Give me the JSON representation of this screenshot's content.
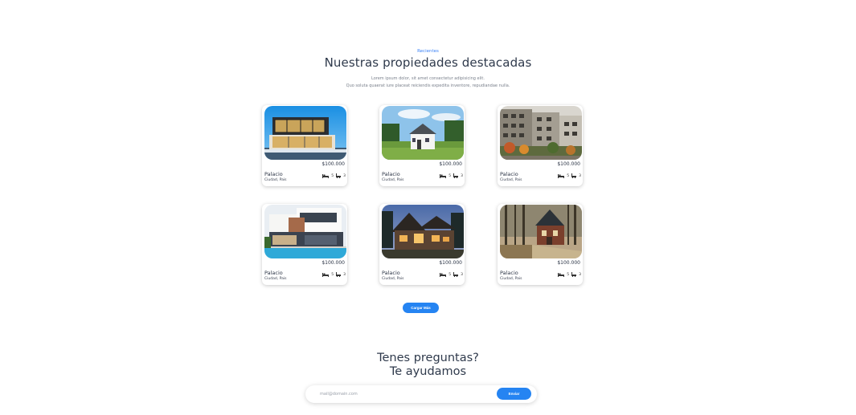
{
  "featured": {
    "eyebrow": "Recientes",
    "title": "Nuestras propiedades destacadas",
    "subtitle_line1": "Lorem ipsum dolor, sit amet consectetur adipisicing elit.",
    "subtitle_line2": "Quo soluta quaerat iure placeat reiciendis expedita inventore, repudiandae nulla."
  },
  "properties": [
    {
      "price": "$100.000",
      "name": "Palacio",
      "location": "Ciudad, Pais",
      "beds": "5",
      "baths": "3",
      "photo": "modern-glass-house"
    },
    {
      "price": "$100.000",
      "name": "Palacio",
      "location": "Ciudad, Pais",
      "beds": "5",
      "baths": "3",
      "photo": "white-cottage"
    },
    {
      "price": "$100.000",
      "name": "Palacio",
      "location": "Ciudad, Pais",
      "beds": "5",
      "baths": "3",
      "photo": "apartment-block"
    },
    {
      "price": "$100.000",
      "name": "Palacio",
      "location": "Ciudad, Pais",
      "beds": "5",
      "baths": "3",
      "photo": "pool-villa"
    },
    {
      "price": "$100.000",
      "name": "Palacio",
      "location": "Ciudad, Pais",
      "beds": "5",
      "baths": "3",
      "photo": "dusk-house"
    },
    {
      "price": "$100.000",
      "name": "Palacio",
      "location": "Ciudad, Pais",
      "beds": "5",
      "baths": "3",
      "photo": "forest-brick-house"
    }
  ],
  "load_more_label": "Cargar Más",
  "faq": {
    "title_line1": "Tenes preguntas?",
    "title_line2": "Te ayudamos"
  },
  "newsletter": {
    "placeholder": "mail@domain.com",
    "send_label": "Enviar"
  },
  "colors": {
    "accent": "#2584f2",
    "heading": "#2f3a4c"
  }
}
